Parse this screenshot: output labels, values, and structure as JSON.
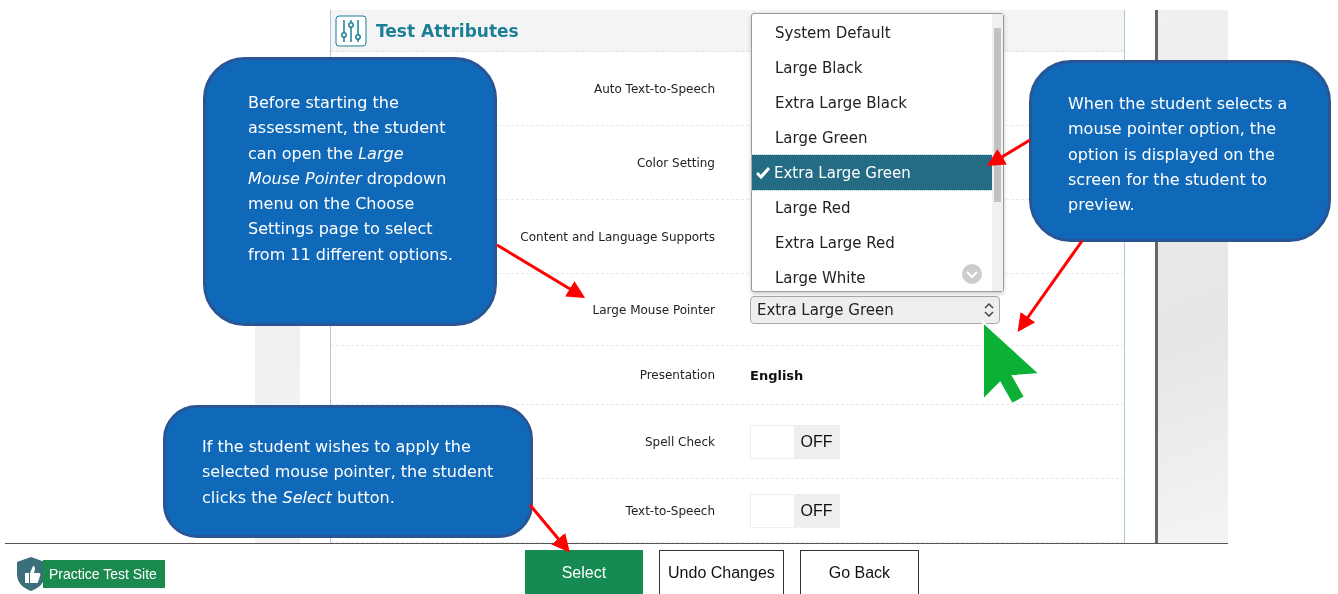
{
  "panel": {
    "title": "Test Attributes"
  },
  "settings": [
    {
      "label": "Auto Text-to-Speech",
      "kind": "blank"
    },
    {
      "label": "Color Setting",
      "kind": "blank"
    },
    {
      "label": "Content and Language Supports",
      "kind": "blank"
    },
    {
      "label": "Large Mouse Pointer",
      "kind": "select",
      "value": "Extra Large Green"
    },
    {
      "label": "Presentation",
      "kind": "text",
      "value": "English"
    },
    {
      "label": "Spell Check",
      "kind": "toggle",
      "on": false,
      "value": "OFF"
    },
    {
      "label": "Text-to-Speech",
      "kind": "toggle",
      "on": false,
      "value": "OFF"
    }
  ],
  "dropdown": {
    "options": [
      {
        "label": "System Default",
        "selected": false
      },
      {
        "label": "Large Black",
        "selected": false
      },
      {
        "label": "Extra Large Black",
        "selected": false
      },
      {
        "label": "Large Green",
        "selected": false
      },
      {
        "label": "Extra Large Green",
        "selected": true
      },
      {
        "label": "Large Red",
        "selected": false
      },
      {
        "label": "Extra Large Red",
        "selected": false
      },
      {
        "label": "Large White",
        "selected": false
      }
    ]
  },
  "callouts": [
    {
      "text": "Before starting the assessment, the student can open the *Large Mouse Pointer* dropdown menu on the Choose Settings page to select from 11 different options."
    },
    {
      "text": "When the student selects a mouse pointer option, the option is displayed on the screen for the student to preview."
    },
    {
      "text": "If the student wishes to apply the selected mouse pointer, the student clicks the *Select* button."
    }
  ],
  "footer": {
    "logo": "Practice Test Site",
    "buttons": [
      {
        "label": "Select",
        "primary": true
      },
      {
        "label": "Undo Changes",
        "primary": false
      },
      {
        "label": "Go Back",
        "primary": false
      }
    ]
  }
}
